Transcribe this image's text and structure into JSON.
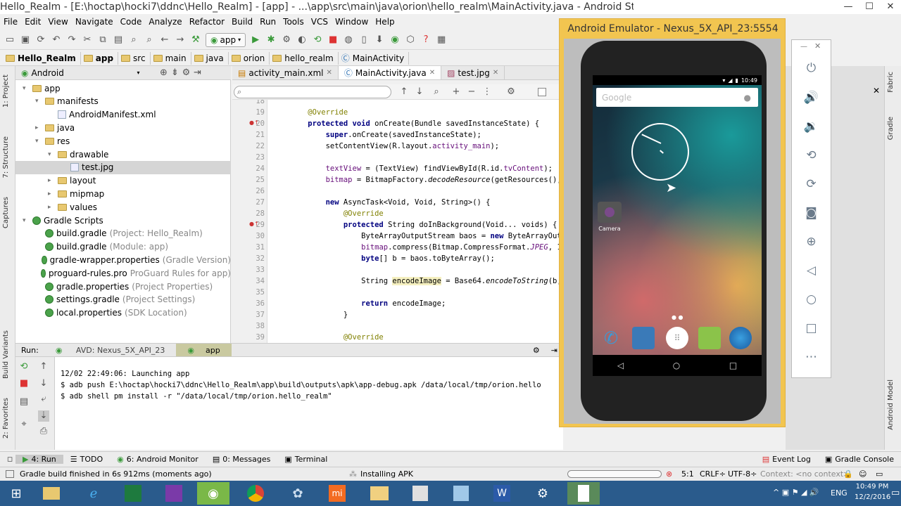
{
  "window": {
    "title": "Hello_Realm - [E:\\hoctap\\hocki7\\ddnc\\Hello_Realm] - [app] - ...\\app\\src\\main\\java\\orion\\hello_realm\\MainActivity.java - Android Studio 2.2.2"
  },
  "menu": [
    "File",
    "Edit",
    "View",
    "Navigate",
    "Code",
    "Analyze",
    "Refactor",
    "Build",
    "Run",
    "Tools",
    "VCS",
    "Window",
    "Help"
  ],
  "toolbar": {
    "run_config": "app"
  },
  "breadcrumb": [
    "Hello_Realm",
    "app",
    "src",
    "main",
    "java",
    "orion",
    "hello_realm",
    "MainActivity"
  ],
  "project": {
    "view": "Android",
    "tree": [
      {
        "label": "app",
        "dim": "",
        "depth": 0,
        "arrow": "▾"
      },
      {
        "label": "manifests",
        "dim": "",
        "depth": 1,
        "arrow": "▾"
      },
      {
        "label": "AndroidManifest.xml",
        "dim": "",
        "depth": 2,
        "arrow": ""
      },
      {
        "label": "java",
        "dim": "",
        "depth": 1,
        "arrow": "▸"
      },
      {
        "label": "res",
        "dim": "",
        "depth": 1,
        "arrow": "▾"
      },
      {
        "label": "drawable",
        "dim": "",
        "depth": 2,
        "arrow": "▾"
      },
      {
        "label": "test.jpg",
        "dim": "",
        "depth": 3,
        "arrow": ""
      },
      {
        "label": "layout",
        "dim": "",
        "depth": 2,
        "arrow": "▸"
      },
      {
        "label": "mipmap",
        "dim": "",
        "depth": 2,
        "arrow": "▸"
      },
      {
        "label": "values",
        "dim": "",
        "depth": 2,
        "arrow": "▸"
      },
      {
        "label": "Gradle Scripts",
        "dim": "",
        "depth": 0,
        "arrow": "▾"
      },
      {
        "label": "build.gradle",
        "dim": "(Project: Hello_Realm)",
        "depth": 1,
        "arrow": ""
      },
      {
        "label": "build.gradle",
        "dim": "(Module: app)",
        "depth": 1,
        "arrow": ""
      },
      {
        "label": "gradle-wrapper.properties",
        "dim": "(Gradle Version)",
        "depth": 1,
        "arrow": ""
      },
      {
        "label": "proguard-rules.pro",
        "dim": "ProGuard Rules for app)",
        "depth": 1,
        "arrow": ""
      },
      {
        "label": "gradle.properties",
        "dim": "(Project Properties)",
        "depth": 1,
        "arrow": ""
      },
      {
        "label": "settings.gradle",
        "dim": "(Project Settings)",
        "depth": 1,
        "arrow": ""
      },
      {
        "label": "local.properties",
        "dim": "(SDK Location)",
        "depth": 1,
        "arrow": ""
      }
    ]
  },
  "left_strip": [
    "1: Project",
    "7: Structure",
    "Captures",
    "Build Variants",
    "2: Favorites"
  ],
  "right_strip": [
    "Fabric",
    "Gradle",
    "Android Model"
  ],
  "tabs": [
    "activity_main.xml",
    "MainActivity.java",
    "test.jpg"
  ],
  "editor_lines": [
    {
      "n": "18",
      "html": ""
    },
    {
      "n": "19",
      "html": "    <span class='ann'>@Override</span>"
    },
    {
      "n": "20",
      "html": "    <span class='kw'>protected void</span> onCreate(Bundle savedInstanceState) {"
    },
    {
      "n": "21",
      "html": "        <span class='kw'>super</span>.onCreate(savedInstanceState);"
    },
    {
      "n": "22",
      "html": "        setContentView(R.layout.<span class='fld'>activity_main</span>);"
    },
    {
      "n": "23",
      "html": ""
    },
    {
      "n": "24",
      "html": "        <span class='fld'>textView</span> = (TextView) findViewById(R.id.<span class='fld'>tvContent</span>);"
    },
    {
      "n": "25",
      "html": "        <span class='fld'>bitmap</span> = BitmapFactory.<i>decodeResource</i>(getResources(), R"
    },
    {
      "n": "26",
      "html": ""
    },
    {
      "n": "27",
      "html": "        <span class='kw'>new</span> AsyncTask&lt;Void, Void, String&gt;() {"
    },
    {
      "n": "28",
      "html": "            <span class='ann'>@Override</span>"
    },
    {
      "n": "29",
      "html": "            <span class='kw'>protected</span> String doInBackground(Void... voids) {"
    },
    {
      "n": "30",
      "html": "                ByteArrayOutputStream baos = <span class='kw'>new</span> ByteArrayOutpu"
    },
    {
      "n": "31",
      "html": "                <span class='fld'>bitmap</span>.compress(Bitmap.CompressFormat.<span class='fld'><i>JPEG</i></span>, 10("
    },
    {
      "n": "32",
      "html": "                <span class='kw'>byte</span>[] b = baos.toByteArray();"
    },
    {
      "n": "33",
      "html": ""
    },
    {
      "n": "34",
      "html": "                String <span style='background:#f5f0c0'>encodeImage</span> = Base64.<i>encodeToString</i>(b, B"
    },
    {
      "n": "35",
      "html": ""
    },
    {
      "n": "36",
      "html": "                <span class='kw'>return</span> encodeImage;"
    },
    {
      "n": "37",
      "html": "            }"
    },
    {
      "n": "38",
      "html": ""
    },
    {
      "n": "39",
      "html": "            <span class='ann'>@Override</span>"
    }
  ],
  "run": {
    "label": "Run:",
    "tabs": [
      "AVD: Nexus_5X_API_23",
      "app"
    ],
    "console": [
      "12/02 22:49:06: Launching app",
      "$ adb push E:\\hoctap\\hocki7\\ddnc\\Hello_Realm\\app\\build\\outputs\\apk\\app-debug.apk /data/local/tmp/orion.hello",
      "$ adb shell pm install -r \"/data/local/tmp/orion.hello_realm\""
    ]
  },
  "bottom_tabs": [
    "4: Run",
    "TODO",
    "6: Android Monitor",
    "0: Messages",
    "Terminal"
  ],
  "bottom_right_tabs": [
    "Event Log",
    "Gradle Console"
  ],
  "status": {
    "message": "Gradle build finished in 6s 912ms (moments ago)",
    "task": "Installing APK",
    "position": "5:1",
    "line_sep": "CRLF÷",
    "encoding": "UTF-8÷",
    "context": "Context: <no context>"
  },
  "emulator": {
    "title": "Android Emulator - Nexus_5X_API_23:5554",
    "time": "10:49",
    "search_hint": "Google",
    "app_label": "Camera"
  },
  "taskbar": {
    "lang": "ENG",
    "time": "10:49 PM",
    "date": "12/2/2016"
  },
  "colors": {
    "accent": "#2a5b8c",
    "emulator_frame": "#f2c550",
    "run_green": "#3a9a3a"
  }
}
